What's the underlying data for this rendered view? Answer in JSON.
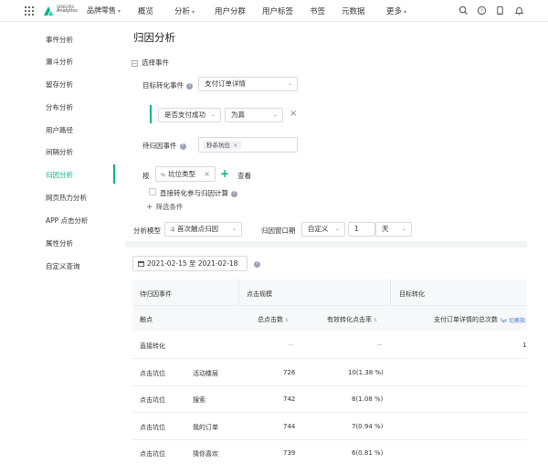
{
  "topbar": {
    "brand_line1": "SENSORS",
    "brand_line2": "Analytics",
    "project": "品牌零售",
    "nav": [
      "概览",
      "分析",
      "用户分群",
      "用户标签",
      "书签",
      "元数据",
      "更多"
    ]
  },
  "sidebar": {
    "items": [
      "事件分析",
      "漏斗分析",
      "留存分析",
      "分布分析",
      "用户路径",
      "间隔分析",
      "归因分析",
      "网页热力分析",
      "APP 点击分析",
      "属性分析",
      "自定义查询"
    ],
    "active_index": 6
  },
  "page": {
    "title": "归因分析",
    "select_event_label": "选择事件",
    "target_event_label": "目标转化事件",
    "target_event_value": "支付订单详情",
    "filter_prop": "是否支付成功",
    "filter_op": "为真",
    "attribution_event_label": "待归因事件",
    "attribution_event_tag": "秒杀坑位",
    "by_label": "按",
    "group_prop": "坑位类型",
    "view_label": "查看",
    "direct_conv_label": "直接转化参与归因计算",
    "add_filter_label": "筛选条件",
    "model_label": "分析模型",
    "model_value": "首次触点归因",
    "window_label": "归因窗口期",
    "window_type": "自定义",
    "window_num": "1",
    "window_unit": "天",
    "date_range": "2021-02-15 至 2021-02-18"
  },
  "table": {
    "group_header": "待归因事件",
    "click_header": "点击规模",
    "target_header": "目标转化",
    "touch_header": "触点",
    "total_clicks_header": "总点击数",
    "effective_rate_header": "有效转化点击率",
    "payment_header": "支付订单详情的总次数",
    "switch_label": "切换指",
    "rows": [
      {
        "c1": "直接转化",
        "c2": "",
        "total": "--",
        "rate": "--",
        "pay": "1"
      },
      {
        "c1": "点击坑位",
        "c2": "活动楼层",
        "total": "726",
        "rate": "10(1.38 %)",
        "pay": ""
      },
      {
        "c1": "点击坑位",
        "c2": "搜索",
        "total": "742",
        "rate": "8(1.08 %)",
        "pay": ""
      },
      {
        "c1": "点击坑位",
        "c2": "我的订单",
        "total": "744",
        "rate": "7(0.94 %)",
        "pay": ""
      },
      {
        "c1": "点击坑位",
        "c2": "猜你喜欢",
        "total": "739",
        "rate": "6(0.81 %)",
        "pay": ""
      }
    ]
  },
  "colors": {
    "accent": "#00b38a",
    "help": "#9aa3b5"
  }
}
